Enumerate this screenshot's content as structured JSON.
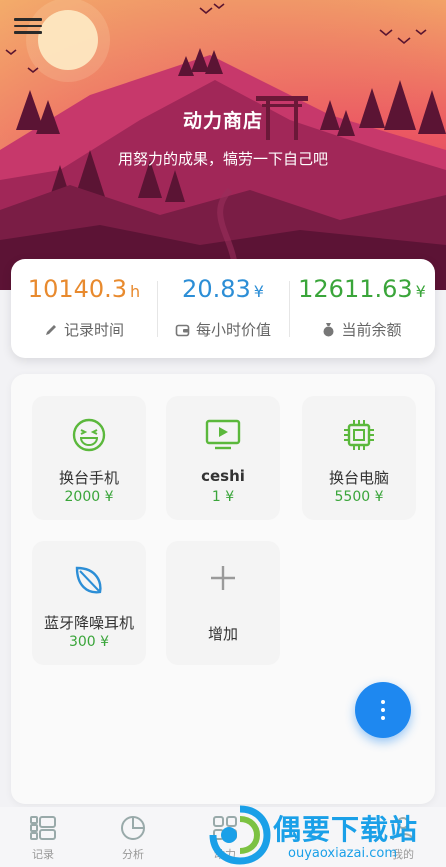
{
  "header": {
    "title": "动力商店",
    "subtitle": "用努力的成果，犒劳一下自己吧"
  },
  "stats": [
    {
      "value": "10140.3",
      "unit": "h",
      "label": "记录时间",
      "icon": "pencil-icon",
      "color": "#e88a2e"
    },
    {
      "value": "20.83",
      "unit": "¥",
      "label": "每小时价值",
      "icon": "wallet-icon",
      "color": "#2c8ed6"
    },
    {
      "value": "12611.63",
      "unit": "¥",
      "label": "当前余额",
      "icon": "money-bag-icon",
      "color": "#3aa53a"
    }
  ],
  "items": [
    {
      "name": "换台手机",
      "price": "2000 ¥",
      "icon": "laughing-face-icon"
    },
    {
      "name": "ceshi",
      "price": "1 ¥",
      "icon": "tv-play-icon"
    },
    {
      "name": "换台电脑",
      "price": "5500 ¥",
      "icon": "cpu-chip-icon"
    },
    {
      "name": "蓝牙降噪耳机",
      "price": "300 ¥",
      "icon": "leaf-icon"
    }
  ],
  "add_item": {
    "label": "增加",
    "icon": "plus-icon"
  },
  "bottom_nav": [
    {
      "label": "记录",
      "icon": "list-icon"
    },
    {
      "label": "分析",
      "icon": "pie-chart-icon"
    },
    {
      "label": "动力",
      "icon": "grid-icon"
    },
    {
      "label": "我的",
      "icon": "user-icon"
    }
  ],
  "watermark": {
    "title": "偶要下载站",
    "subtitle": "ouyaoxiazai.com"
  },
  "colors": {
    "accent_green": "#3aa53a",
    "fab_blue": "#1e88f0",
    "orange": "#e88a2e",
    "blue": "#2c8ed6"
  }
}
